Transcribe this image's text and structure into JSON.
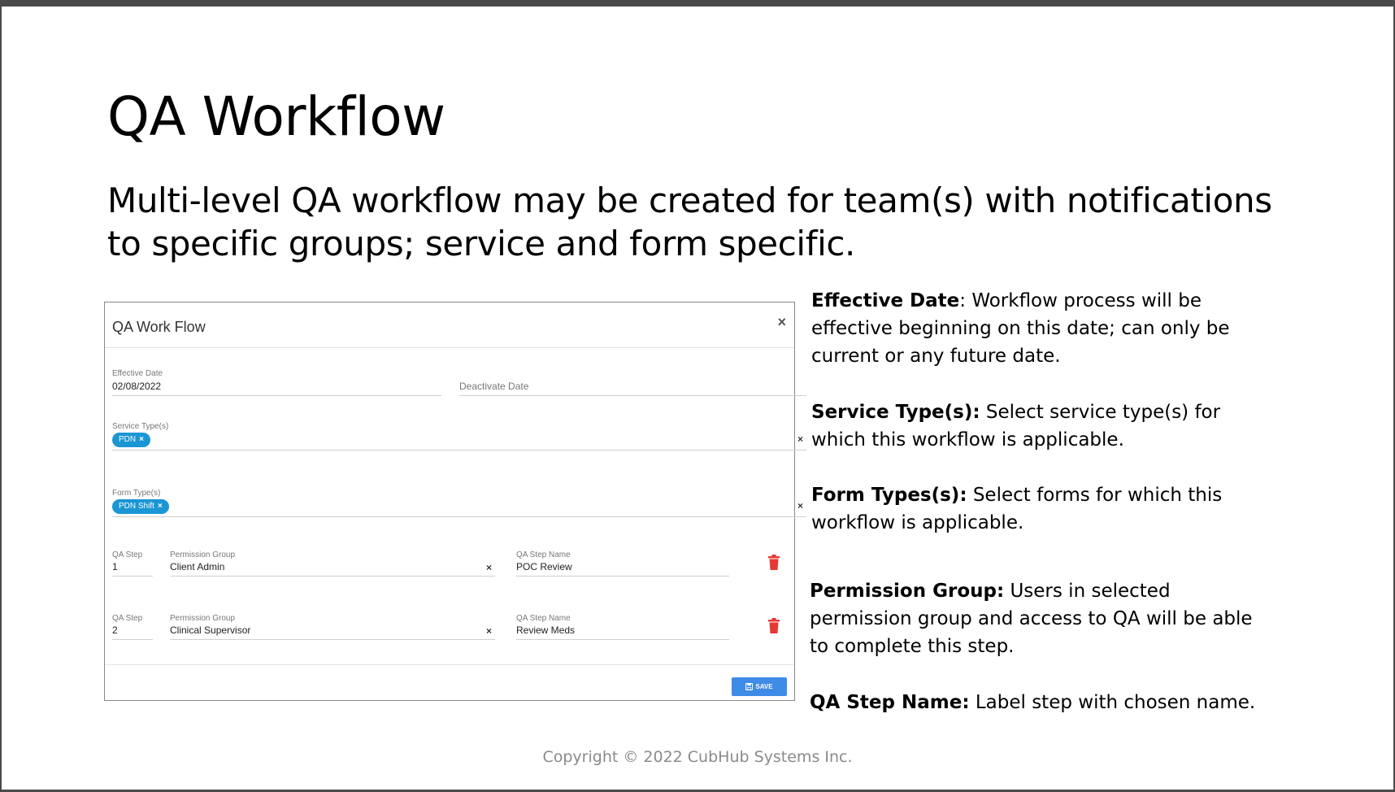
{
  "slide": {
    "title": "QA Workflow",
    "subtitle": "Multi-level QA workflow may be created for team(s) with notifications to specific groups; service and form specific.",
    "copyright": "Copyright © 2022 CubHub Systems Inc."
  },
  "modal": {
    "title": "QA Work Flow",
    "close_icon": "×",
    "effective_date": {
      "label": "Effective Date",
      "value": "02/08/2022"
    },
    "deactivate_date": {
      "placeholder": "Deactivate Date"
    },
    "service_types": {
      "label": "Service Type(s)",
      "chips": [
        "PDN"
      ],
      "clear": "×"
    },
    "form_types": {
      "label": "Form Type(s)",
      "chips": [
        "PDN Shift"
      ],
      "clear": "×"
    },
    "steps": [
      {
        "step_label": "QA Step",
        "step": "1",
        "group_label": "Permission Group",
        "group": "Client Admin",
        "name_label": "QA Step Name",
        "name": "POC Review"
      },
      {
        "step_label": "QA Step",
        "step": "2",
        "group_label": "Permission Group",
        "group": "Clinical Supervisor",
        "name_label": "QA Step Name",
        "name": "Review Meds"
      }
    ],
    "save_label": "SAVE",
    "chip_remove": "×",
    "accent_color": "#1a96d4",
    "save_color": "#3f8be8",
    "trash_color": "#e53935"
  },
  "explanations": [
    {
      "term": "Effective Date",
      "text": ": Workflow process will be effective beginning on this date; can only be current or any future date."
    },
    {
      "term": "Service Type(s):",
      "text": " Select service type(s) for which this workflow is applicable."
    },
    {
      "term": "Form Types(s):",
      "text": " Select forms for which this workflow is applicable."
    },
    {
      "term": "Permission Group:",
      "text": " Users in selected permission group and access to QA will be able to complete this step."
    },
    {
      "term": "QA Step Name:",
      "text": " Label step with chosen name."
    }
  ]
}
